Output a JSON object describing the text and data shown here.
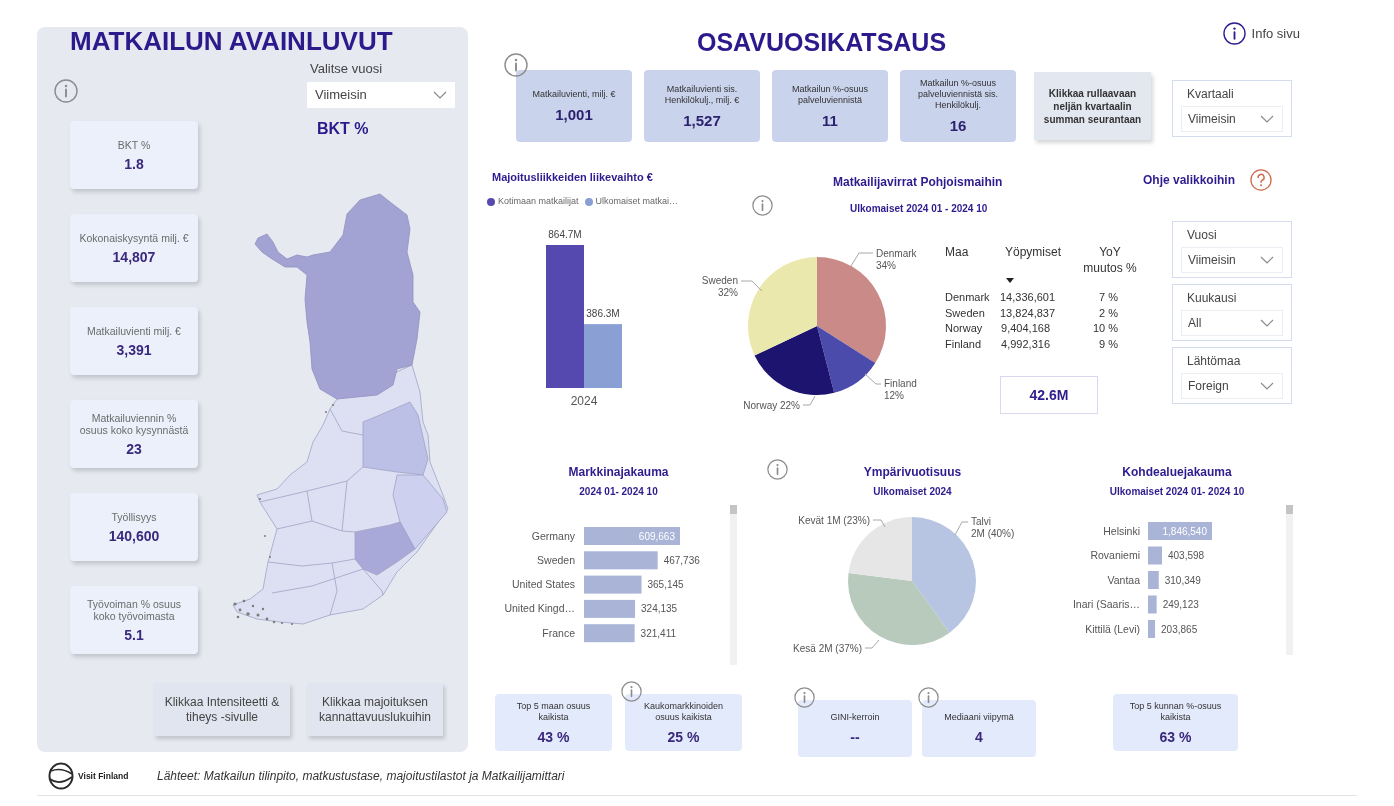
{
  "key_figures": {
    "title": "MATKAILUN AVAINLUVUT",
    "year_filter": {
      "label": "Valitse vuosi",
      "value": "Viimeisin"
    },
    "map_title": "BKT %",
    "cards": [
      {
        "label": "BKT %",
        "value": "1.8"
      },
      {
        "label": "Kokonaiskysyntä milj. €",
        "value": "14,807"
      },
      {
        "label": "Matkailuvienti milj. €",
        "value": "3,391"
      },
      {
        "label": "Matkailuviennin % osuus koko kysynnästä",
        "value": "23"
      },
      {
        "label": "Työllisyys",
        "value": "140,600"
      },
      {
        "label": "Työvoiman % osuus koko työvoimasta",
        "value": "5.1"
      }
    ],
    "buttons": [
      "Klikkaa Intensiteetti & tiheys -sivulle",
      "Klikkaa majoituksen kannattavuuslukuihin"
    ]
  },
  "quarterly_review": {
    "title": "OSAVUOSIKATSAUS",
    "info_link": "Info sivu",
    "cards": [
      {
        "label": "Matkailuvienti, milj. €",
        "value": "1,001"
      },
      {
        "label": "Matkailuvienti sis. Henkilökulj., milj. €",
        "value": "1,527"
      },
      {
        "label": "Matkailun %-osuus palveluviennistä",
        "value": "11"
      },
      {
        "label": "Matkailun %-osuus palveluviennistä sis. Henkilökulj.",
        "value": "16"
      }
    ],
    "rolling_button": "Klikkaa rullaavaan neljän kvartaalin summan seurantaan",
    "quarter_filter": {
      "label": "Kvartaali",
      "value": "Viimeisin"
    }
  },
  "accommodation_revenue": {
    "title": "Majoitusliikkeiden liikevaihto €",
    "legend": [
      "Kotimaan matkailijat",
      "Ulkomaiset matkai…"
    ],
    "chart_data": {
      "type": "bar",
      "xlabel": "2024",
      "values": [
        864.7,
        386.3
      ],
      "value_labels": [
        "864.7M",
        "386.3M"
      ],
      "colors": [
        "#5549b0",
        "#8a9fd4"
      ]
    }
  },
  "nordic_flows": {
    "title": "Matkailijavirrat Pohjoismaihin",
    "subtitle": "Ulkomaiset 2024 01 - 2024 10",
    "chart_data": {
      "type": "pie",
      "categories": [
        "Denmark",
        "Finland",
        "Norway",
        "Sweden"
      ],
      "values": [
        34,
        12,
        22,
        32
      ],
      "value_labels": [
        "34%",
        "12%",
        "22%",
        "32%"
      ],
      "colors": [
        "#c98a88",
        "#4a4bab",
        "#1d1470",
        "#ebe8ad"
      ]
    },
    "table": {
      "columns": [
        {
          "label": "Maa",
          "sorted": false
        },
        {
          "label": "Yöpymiset",
          "sorted": true
        },
        {
          "label": "YoY muutos %",
          "sorted": false
        }
      ],
      "rows": [
        [
          "Denmark",
          "14,336,601",
          "7 %"
        ],
        [
          "Sweden",
          "13,824,837",
          "2 %"
        ],
        [
          "Norway",
          "9,404,168",
          "10 %"
        ],
        [
          "Finland",
          "4,992,316",
          "9 %"
        ]
      ]
    },
    "total": "42.6M"
  },
  "menu_help": {
    "label": "Ohje valikkoihin"
  },
  "filters": [
    {
      "label": "Vuosi",
      "value": "Viimeisin"
    },
    {
      "label": "Kuukausi",
      "value": "All"
    },
    {
      "label": "Lähtömaa",
      "value": "Foreign"
    }
  ],
  "market_distribution": {
    "title": "Markkinajakauma",
    "subtitle": "2024 01- 2024 10",
    "chart_data": {
      "type": "bar",
      "orientation": "horizontal",
      "categories": [
        "Germany",
        "Sweden",
        "United States",
        "United Kingd…",
        "France"
      ],
      "values": [
        609663,
        467736,
        365145,
        324135,
        321411
      ],
      "value_labels": [
        "609,663",
        "467,736",
        "365,145",
        "324,135",
        "321,411"
      ]
    },
    "cards": [
      {
        "label": "Top 5 maan osuus kaikista",
        "value": "43 %",
        "info": false
      },
      {
        "label": "Kaukomarkkinoiden osuus kaikista",
        "value": "25 %",
        "info": true
      }
    ]
  },
  "seasonality": {
    "title": "Ympärivuotisuus",
    "subtitle": "Ulkomaiset 2024",
    "chart_data": {
      "type": "pie",
      "categories": [
        "Talvi",
        "Kesä",
        "Kevät"
      ],
      "values": [
        40,
        37,
        23
      ],
      "value_labels": [
        "2M (40%)",
        "2M (37%)",
        "1M (23%)"
      ],
      "colors": [
        "#b8c5e2",
        "#b7cabc",
        "#e6e6e6"
      ]
    },
    "cards": [
      {
        "label": "GINI-kerroin",
        "value": "--",
        "info": true
      },
      {
        "label": "Mediaani viipymä",
        "value": "4",
        "info": true
      }
    ]
  },
  "destination_distribution": {
    "title": "Kohdealuejakauma",
    "subtitle": "Ulkomaiset 2024 01- 2024 10",
    "chart_data": {
      "type": "bar",
      "orientation": "horizontal",
      "categories": [
        "Helsinki",
        "Rovaniemi",
        "Vantaa",
        "Inari (Saaris…",
        "Kittilä (Levi)"
      ],
      "values": [
        1846540,
        403598,
        310349,
        249123,
        203865
      ],
      "value_labels": [
        "1,846,540",
        "403,598",
        "310,349",
        "249,123",
        "203,865"
      ]
    },
    "cards": [
      {
        "label": "Top 5 kunnan %-osuus kaikista",
        "value": "63 %",
        "info": false
      }
    ]
  },
  "footer": {
    "logo_text": "Visit Finland",
    "sources": "Lähteet: Matkailun tilinpito, matkustustase, majoitustilastot ja Matkailijamittari"
  }
}
